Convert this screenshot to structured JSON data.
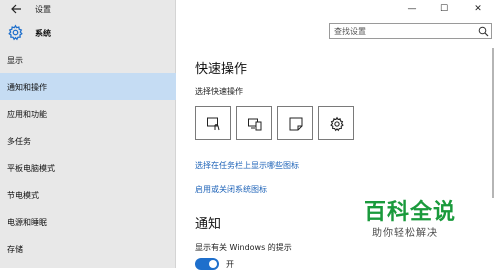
{
  "window": {
    "title": "设置",
    "min_glyph": "—",
    "max_glyph": "☐",
    "close_glyph": "✕"
  },
  "brand": {
    "label": "系统"
  },
  "search": {
    "placeholder": "查找设置"
  },
  "sidebar": {
    "items": [
      {
        "label": "显示",
        "selected": false
      },
      {
        "label": "通知和操作",
        "selected": true
      },
      {
        "label": "应用和功能",
        "selected": false
      },
      {
        "label": "多任务",
        "selected": false
      },
      {
        "label": "平板电脑模式",
        "selected": false
      },
      {
        "label": "节电模式",
        "selected": false
      },
      {
        "label": "电源和睡眠",
        "selected": false
      },
      {
        "label": "存储",
        "selected": false
      }
    ]
  },
  "main": {
    "quick_actions_title": "快速操作",
    "quick_actions_subtitle": "选择快速操作",
    "quick_action_icons": [
      "tablet-mode-icon",
      "connect-icon",
      "note-icon",
      "settings-icon"
    ],
    "link_taskbar_icons": "选择在任务栏上显示哪些图标",
    "link_system_icons": "启用或关闭系统图标",
    "notifications_title": "通知",
    "windows_tips_label": "显示有关 Windows 的提示",
    "windows_tips_toggle": "开"
  },
  "watermark": {
    "title": "百科全说",
    "subtitle": "助你轻松解决"
  },
  "colors": {
    "accent": "#1e6fcc",
    "link": "#1e63b8",
    "sidebar_bg": "#e8e8e8",
    "selected_bg": "#c5dcf3",
    "watermark_green": "#1a9a3c"
  }
}
